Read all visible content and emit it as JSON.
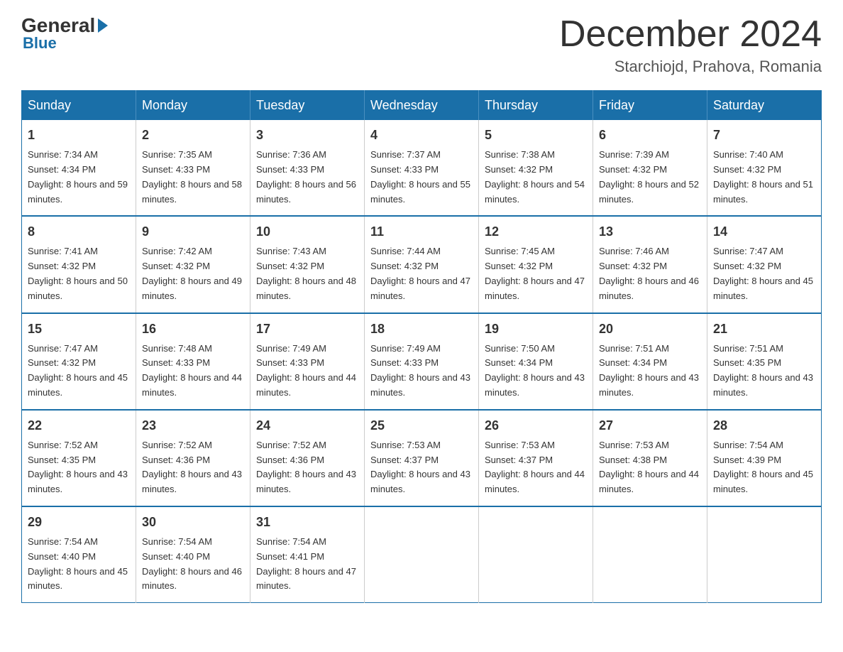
{
  "header": {
    "logo_general": "General",
    "logo_blue": "Blue",
    "month_title": "December 2024",
    "location": "Starchiojd, Prahova, Romania"
  },
  "days_of_week": [
    "Sunday",
    "Monday",
    "Tuesday",
    "Wednesday",
    "Thursday",
    "Friday",
    "Saturday"
  ],
  "weeks": [
    [
      {
        "day": "1",
        "sunrise": "7:34 AM",
        "sunset": "4:34 PM",
        "daylight": "8 hours and 59 minutes."
      },
      {
        "day": "2",
        "sunrise": "7:35 AM",
        "sunset": "4:33 PM",
        "daylight": "8 hours and 58 minutes."
      },
      {
        "day": "3",
        "sunrise": "7:36 AM",
        "sunset": "4:33 PM",
        "daylight": "8 hours and 56 minutes."
      },
      {
        "day": "4",
        "sunrise": "7:37 AM",
        "sunset": "4:33 PM",
        "daylight": "8 hours and 55 minutes."
      },
      {
        "day": "5",
        "sunrise": "7:38 AM",
        "sunset": "4:32 PM",
        "daylight": "8 hours and 54 minutes."
      },
      {
        "day": "6",
        "sunrise": "7:39 AM",
        "sunset": "4:32 PM",
        "daylight": "8 hours and 52 minutes."
      },
      {
        "day": "7",
        "sunrise": "7:40 AM",
        "sunset": "4:32 PM",
        "daylight": "8 hours and 51 minutes."
      }
    ],
    [
      {
        "day": "8",
        "sunrise": "7:41 AM",
        "sunset": "4:32 PM",
        "daylight": "8 hours and 50 minutes."
      },
      {
        "day": "9",
        "sunrise": "7:42 AM",
        "sunset": "4:32 PM",
        "daylight": "8 hours and 49 minutes."
      },
      {
        "day": "10",
        "sunrise": "7:43 AM",
        "sunset": "4:32 PM",
        "daylight": "8 hours and 48 minutes."
      },
      {
        "day": "11",
        "sunrise": "7:44 AM",
        "sunset": "4:32 PM",
        "daylight": "8 hours and 47 minutes."
      },
      {
        "day": "12",
        "sunrise": "7:45 AM",
        "sunset": "4:32 PM",
        "daylight": "8 hours and 47 minutes."
      },
      {
        "day": "13",
        "sunrise": "7:46 AM",
        "sunset": "4:32 PM",
        "daylight": "8 hours and 46 minutes."
      },
      {
        "day": "14",
        "sunrise": "7:47 AM",
        "sunset": "4:32 PM",
        "daylight": "8 hours and 45 minutes."
      }
    ],
    [
      {
        "day": "15",
        "sunrise": "7:47 AM",
        "sunset": "4:32 PM",
        "daylight": "8 hours and 45 minutes."
      },
      {
        "day": "16",
        "sunrise": "7:48 AM",
        "sunset": "4:33 PM",
        "daylight": "8 hours and 44 minutes."
      },
      {
        "day": "17",
        "sunrise": "7:49 AM",
        "sunset": "4:33 PM",
        "daylight": "8 hours and 44 minutes."
      },
      {
        "day": "18",
        "sunrise": "7:49 AM",
        "sunset": "4:33 PM",
        "daylight": "8 hours and 43 minutes."
      },
      {
        "day": "19",
        "sunrise": "7:50 AM",
        "sunset": "4:34 PM",
        "daylight": "8 hours and 43 minutes."
      },
      {
        "day": "20",
        "sunrise": "7:51 AM",
        "sunset": "4:34 PM",
        "daylight": "8 hours and 43 minutes."
      },
      {
        "day": "21",
        "sunrise": "7:51 AM",
        "sunset": "4:35 PM",
        "daylight": "8 hours and 43 minutes."
      }
    ],
    [
      {
        "day": "22",
        "sunrise": "7:52 AM",
        "sunset": "4:35 PM",
        "daylight": "8 hours and 43 minutes."
      },
      {
        "day": "23",
        "sunrise": "7:52 AM",
        "sunset": "4:36 PM",
        "daylight": "8 hours and 43 minutes."
      },
      {
        "day": "24",
        "sunrise": "7:52 AM",
        "sunset": "4:36 PM",
        "daylight": "8 hours and 43 minutes."
      },
      {
        "day": "25",
        "sunrise": "7:53 AM",
        "sunset": "4:37 PM",
        "daylight": "8 hours and 43 minutes."
      },
      {
        "day": "26",
        "sunrise": "7:53 AM",
        "sunset": "4:37 PM",
        "daylight": "8 hours and 44 minutes."
      },
      {
        "day": "27",
        "sunrise": "7:53 AM",
        "sunset": "4:38 PM",
        "daylight": "8 hours and 44 minutes."
      },
      {
        "day": "28",
        "sunrise": "7:54 AM",
        "sunset": "4:39 PM",
        "daylight": "8 hours and 45 minutes."
      }
    ],
    [
      {
        "day": "29",
        "sunrise": "7:54 AM",
        "sunset": "4:40 PM",
        "daylight": "8 hours and 45 minutes."
      },
      {
        "day": "30",
        "sunrise": "7:54 AM",
        "sunset": "4:40 PM",
        "daylight": "8 hours and 46 minutes."
      },
      {
        "day": "31",
        "sunrise": "7:54 AM",
        "sunset": "4:41 PM",
        "daylight": "8 hours and 47 minutes."
      },
      null,
      null,
      null,
      null
    ]
  ],
  "labels": {
    "sunrise": "Sunrise:",
    "sunset": "Sunset:",
    "daylight": "Daylight:"
  }
}
